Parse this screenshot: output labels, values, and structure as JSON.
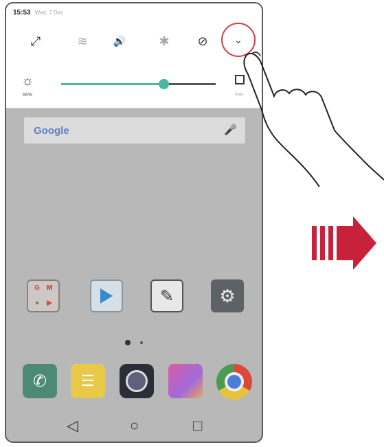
{
  "status_bar": {
    "time": "15:53",
    "date": "Wed, 7 Dec"
  },
  "quick_settings": {
    "toggles": [
      {
        "name": "screen-rotation-icon",
        "glyph": "⤢",
        "state": "on"
      },
      {
        "name": "wifi-off-icon",
        "glyph": "≋",
        "state": "off"
      },
      {
        "name": "sound-icon",
        "glyph": "🔊",
        "state": "on"
      },
      {
        "name": "bluetooth-icon",
        "glyph": "✱",
        "state": "off"
      },
      {
        "name": "do-not-disturb-icon",
        "glyph": "⊘",
        "state": "on"
      }
    ],
    "expand_glyph": "⌄",
    "brightness": {
      "icon": "☼",
      "percent_label": "66%",
      "level": 0.66,
      "auto_label": "Auto"
    }
  },
  "search": {
    "logo": "Google",
    "mic_icon": "🎤"
  },
  "apps": {
    "folder_labels": [
      "G",
      "M",
      "●",
      "▶"
    ],
    "play_store": "play-store-icon",
    "notes": "✎",
    "settings": "⚙"
  },
  "dock": {
    "phone": "✆",
    "messages": "☰",
    "camera": "camera-icon",
    "gallery": "gallery-icon",
    "chrome": "chrome-icon"
  },
  "nav": {
    "back": "◁",
    "home": "○",
    "recents": "□"
  },
  "colors": {
    "accent": "#48b89f",
    "highlight_ring": "#d23b4a",
    "arrow": "#c8213a"
  }
}
